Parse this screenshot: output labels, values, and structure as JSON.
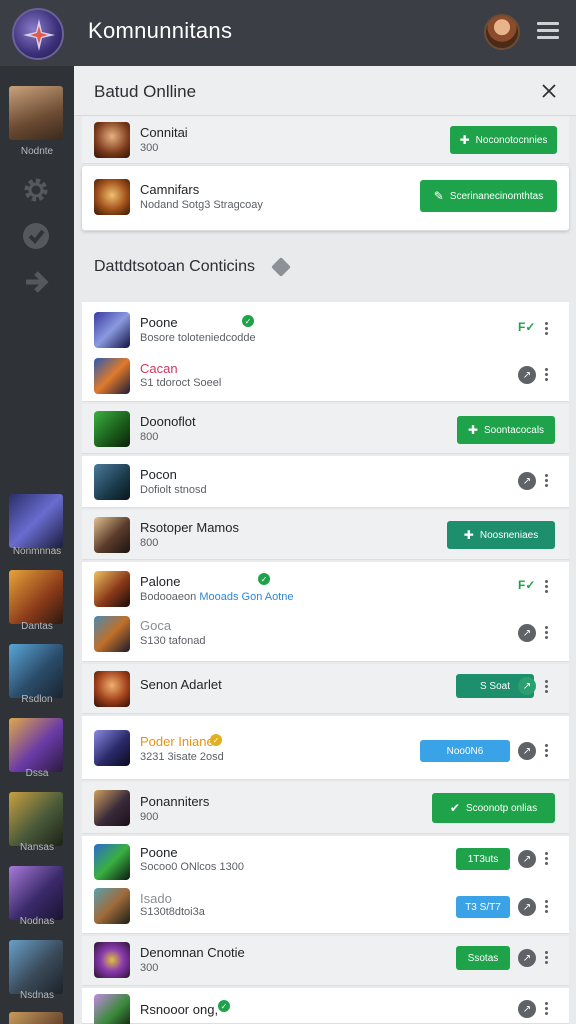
{
  "header": {
    "title": "Komnunnitans"
  },
  "sidebar": {
    "user_label": "Nodnte",
    "games": [
      {
        "label": "Nonmnnas"
      },
      {
        "label": "Dantas"
      },
      {
        "label": "Rsdlon"
      },
      {
        "label": "Dssa"
      },
      {
        "label": "Nansas"
      },
      {
        "label": "Nodnas"
      },
      {
        "label": "Nsdnas"
      }
    ]
  },
  "panel": {
    "title": "Batud Onlline",
    "section_title": "Dattdtsotoan Conticins",
    "top_rows": [
      {
        "name": "Connitai",
        "sub": "300",
        "button": "Noconotocnnies"
      },
      {
        "name": "Camnifars",
        "sub": "Nodand Sotg3 Stragcoay",
        "button": "Scerinanecinomthtas"
      }
    ],
    "rows": [
      {
        "name": "Poone",
        "sub": "Bosore toloteniedcodde"
      },
      {
        "name": "Cacan",
        "sub": "S1 tdoroct Soeel"
      },
      {
        "name": "Doonoflot",
        "sub": "800",
        "button": "Soontacocals"
      },
      {
        "name": "Pocon",
        "sub": "Dofiolt stnosd"
      },
      {
        "name": "Rsotoper Mamos",
        "sub": "800",
        "button": "Noosneniaes"
      },
      {
        "name": "Palone",
        "sub": "Bodooaeon",
        "sub_blue": "Mooads Gon Aotne"
      },
      {
        "name": "Goca",
        "sub": "S130 tafonad"
      },
      {
        "name": "Senon Adarlet",
        "sub": "",
        "button": "S Soat"
      },
      {
        "name": "Poder Iniane",
        "sub": "3231 3isate 2osd",
        "button": "Noo0N6"
      },
      {
        "name": "Ponanniters",
        "sub": "900",
        "button": "Scoonotp onlias"
      },
      {
        "name": "Poone",
        "sub": "Socoo0 ONlcos  1300",
        "button": "1T3uts"
      },
      {
        "name": "Isado",
        "sub": "S130t8dtoi3a",
        "button": "T3 S/T7"
      },
      {
        "name": "Denomnan Cnotie",
        "sub": "300",
        "button": "Ssotas"
      },
      {
        "name": "Rsnooor ong,",
        "sub": ""
      }
    ]
  },
  "colors": {
    "accent_green": "#1ea34b",
    "accent_blue": "#3aa2e6",
    "accent_teal": "#1d8f6c",
    "header_bg": "#3b3e44"
  }
}
